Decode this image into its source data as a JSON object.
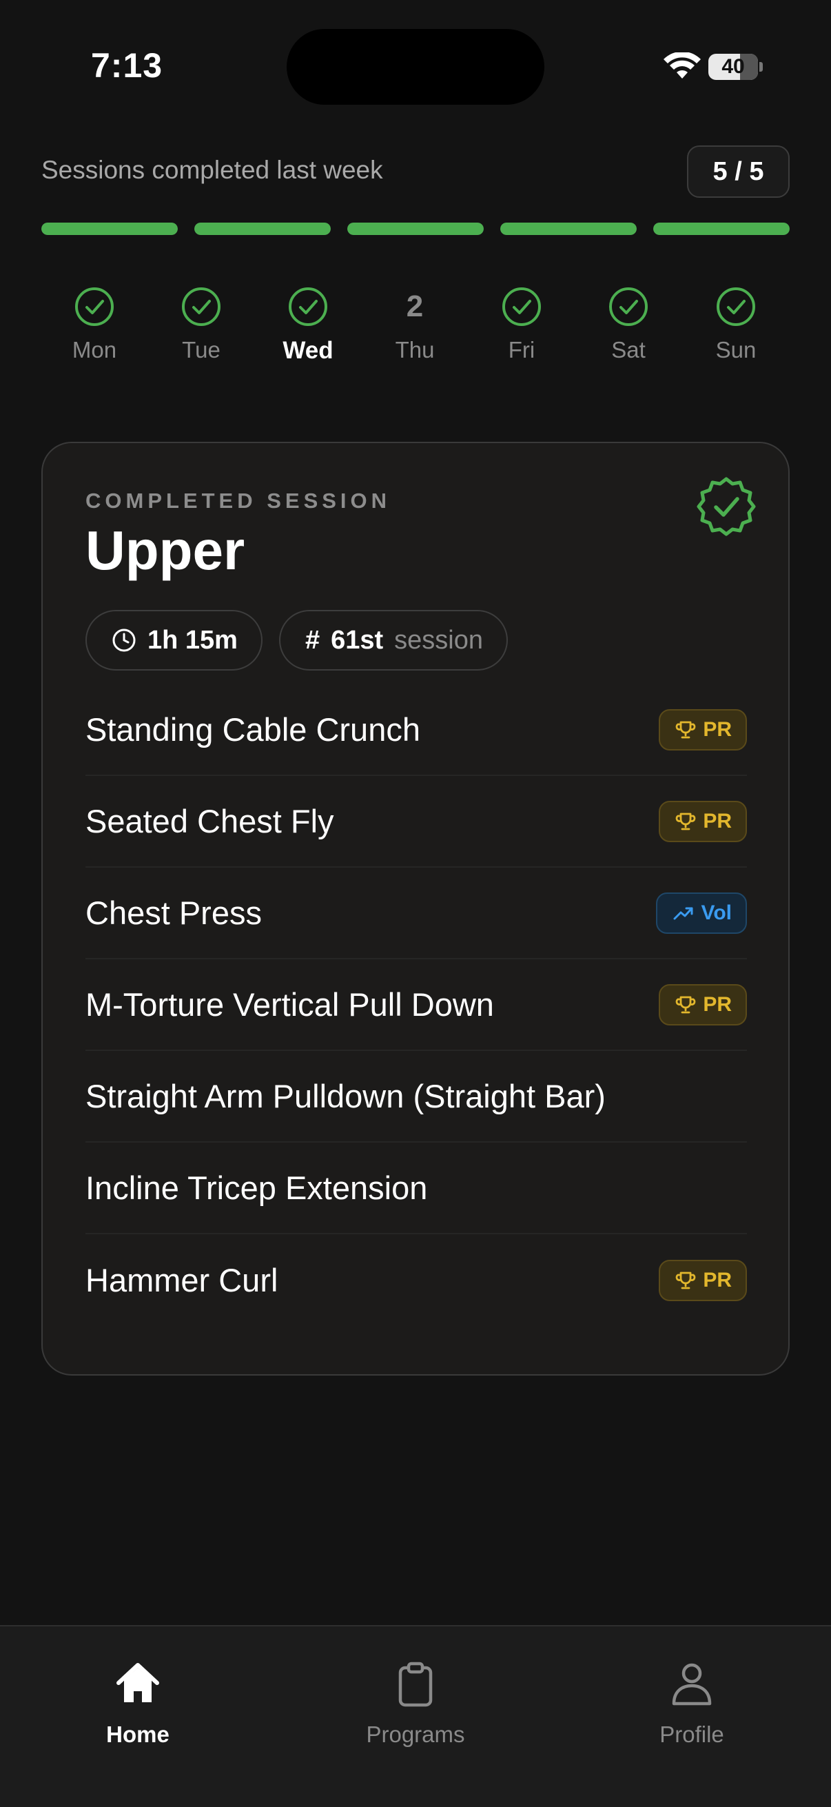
{
  "status_bar": {
    "time": "7:13",
    "battery_level": "40"
  },
  "week": {
    "label": "Sessions completed last week",
    "count": "5 / 5",
    "progress": [
      1,
      1,
      1,
      1,
      1
    ],
    "days": [
      {
        "name": "Mon",
        "done": true,
        "value": ""
      },
      {
        "name": "Tue",
        "done": true,
        "value": ""
      },
      {
        "name": "Wed",
        "done": true,
        "value": "",
        "today": true
      },
      {
        "name": "Thu",
        "done": false,
        "value": "2"
      },
      {
        "name": "Fri",
        "done": true,
        "value": ""
      },
      {
        "name": "Sat",
        "done": true,
        "value": ""
      },
      {
        "name": "Sun",
        "done": true,
        "value": ""
      }
    ]
  },
  "session": {
    "eyebrow": "COMPLETED SESSION",
    "title": "Upper",
    "duration": "1h 15m",
    "ordinal": "61st",
    "ordinal_suffix": "session",
    "exercises": [
      {
        "name": "Standing Cable Crunch",
        "badge": "PR",
        "badge_type": "pr"
      },
      {
        "name": "Seated Chest Fly",
        "badge": "PR",
        "badge_type": "pr"
      },
      {
        "name": "Chest Press",
        "badge": "Vol",
        "badge_type": "vol"
      },
      {
        "name": "M-Torture Vertical Pull Down",
        "badge": "PR",
        "badge_type": "pr"
      },
      {
        "name": "Straight Arm Pulldown (Straight Bar)",
        "badge": "",
        "badge_type": ""
      },
      {
        "name": "Incline Tricep Extension",
        "badge": "",
        "badge_type": ""
      },
      {
        "name": "Hammer Curl",
        "badge": "PR",
        "badge_type": "pr"
      }
    ]
  },
  "tabs": [
    {
      "label": "Home",
      "icon": "home-icon",
      "active": true
    },
    {
      "label": "Programs",
      "icon": "clipboard-icon",
      "active": false
    },
    {
      "label": "Profile",
      "icon": "person-icon",
      "active": false
    }
  ],
  "colors": {
    "background": "#131313",
    "accent_green": "#4caf50",
    "pr_gold": "#e3b72d",
    "vol_blue": "#3a9bf0"
  }
}
